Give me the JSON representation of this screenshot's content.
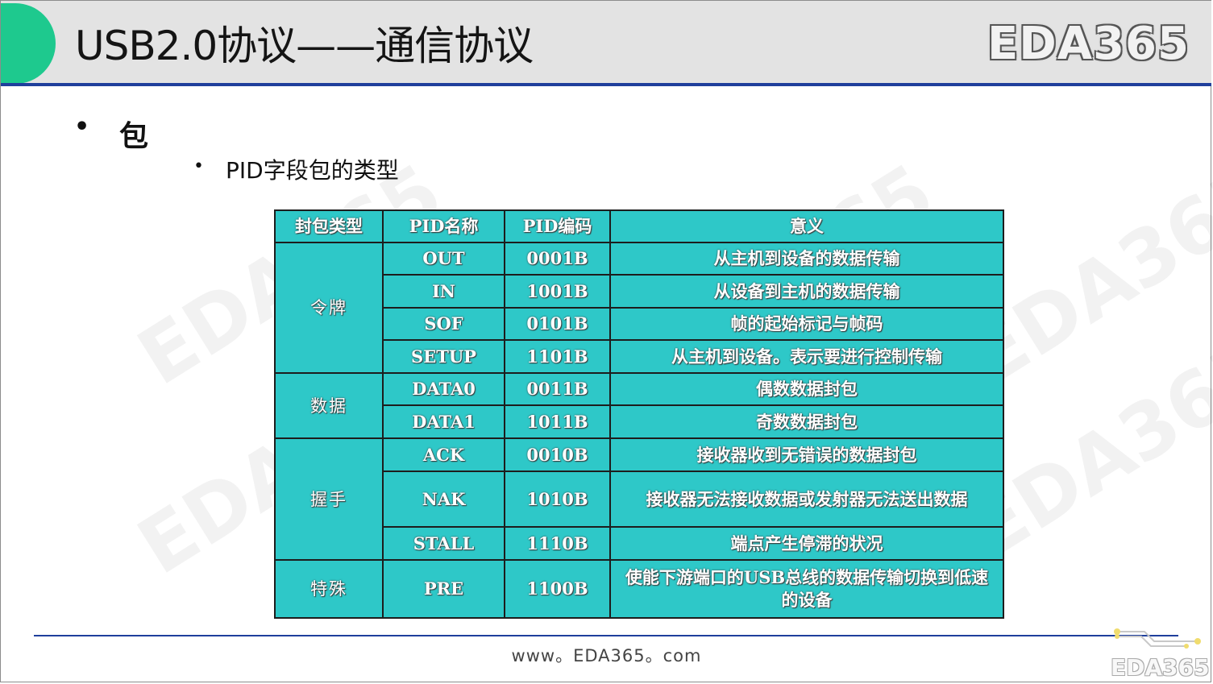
{
  "header": {
    "title": "USB2.0协议——通信协议",
    "logo_text": "EDA365"
  },
  "watermark_text": "EDA365",
  "bullets": {
    "level1": "包",
    "level2": "PID字段包的类型"
  },
  "table": {
    "headers": [
      "封包类型",
      "PID名称",
      "PID编码",
      "意义"
    ],
    "groups": [
      {
        "type": "令牌",
        "rows": [
          {
            "name": "OUT",
            "code": "0001B",
            "meaning": "从主机到设备的数据传输"
          },
          {
            "name": "IN",
            "code": "1001B",
            "meaning": "从设备到主机的数据传输"
          },
          {
            "name": "SOF",
            "code": "0101B",
            "meaning": "帧的起始标记与帧码"
          },
          {
            "name": "SETUP",
            "code": "1101B",
            "meaning": "从主机到设备。表示要进行控制传输"
          }
        ]
      },
      {
        "type": "数据",
        "rows": [
          {
            "name": "DATA0",
            "code": "0011B",
            "meaning": "偶数数据封包"
          },
          {
            "name": "DATA1",
            "code": "1011B",
            "meaning": "奇数数据封包"
          }
        ]
      },
      {
        "type": "握手",
        "rows": [
          {
            "name": "ACK",
            "code": "0010B",
            "meaning": "接收器收到无错误的数据封包"
          },
          {
            "name": "NAK",
            "code": "1010B",
            "meaning": "接收器无法接收数据或发射器无法送出数据"
          },
          {
            "name": "STALL",
            "code": "1110B",
            "meaning": "端点产生停滞的状况"
          }
        ]
      },
      {
        "type": "特殊",
        "rows": [
          {
            "name": "PRE",
            "code": "1100B",
            "meaning": "使能下游端口的USB总线的数据传输切换到低速的设备"
          }
        ]
      }
    ]
  },
  "footer": {
    "url": "www。EDA365。com",
    "logo_text": "EDA365"
  },
  "colors": {
    "accent_green": "#1ec98e",
    "rule_blue": "#1f3f9c",
    "table_cyan": "#2ec8c8"
  }
}
